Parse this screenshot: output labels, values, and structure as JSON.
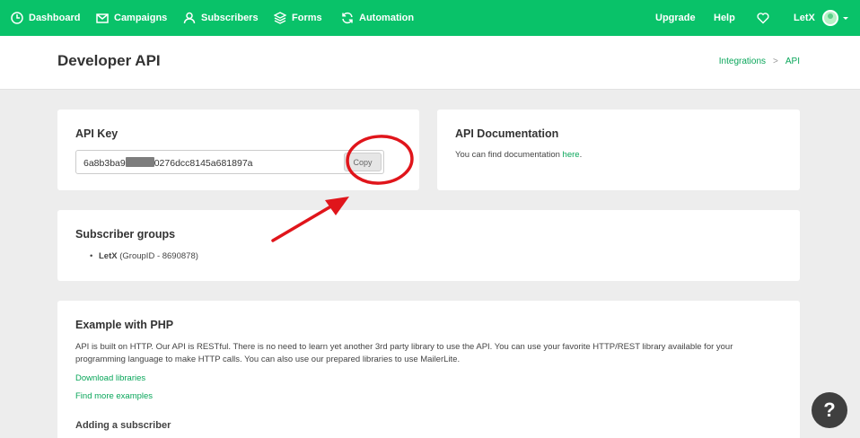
{
  "nav": {
    "dashboard": "Dashboard",
    "campaigns": "Campaigns",
    "subscribers": "Subscribers",
    "forms": "Forms",
    "automation": "Automation",
    "upgrade": "Upgrade",
    "help": "Help",
    "user": "LetX"
  },
  "header": {
    "title": "Developer API",
    "breadcrumb": [
      "Integrations",
      ">",
      "API"
    ]
  },
  "api_key": {
    "title": "API Key",
    "value_prefix": "6a8b3ba9",
    "value_suffix": "0276dcc8145a681897a",
    "copy_label": "Copy"
  },
  "api_docs": {
    "title": "API Documentation",
    "text": "You can find documentation",
    "link": "here",
    "period": "."
  },
  "groups": {
    "title": "Subscriber groups",
    "items": [
      {
        "name": "LetX",
        "detail": "(GroupID - 8690878)"
      }
    ]
  },
  "php": {
    "title": "Example with PHP",
    "line1": "API is built on HTTP. Our API is RESTful. There is no need to learn yet another 3rd party library to use the API. You can use your favorite HTTP/REST library available for your",
    "line2": "programming language to make HTTP calls. You can also use our prepared libraries to use MailerLite.",
    "download_link": "Download libraries",
    "examples_link": "Find more examples",
    "subheading": "Adding a subscriber"
  },
  "help_fab": "?",
  "colors": {
    "brand_green": "#09c269",
    "link_green": "#09a65a",
    "annotation_red": "#e0151b"
  }
}
